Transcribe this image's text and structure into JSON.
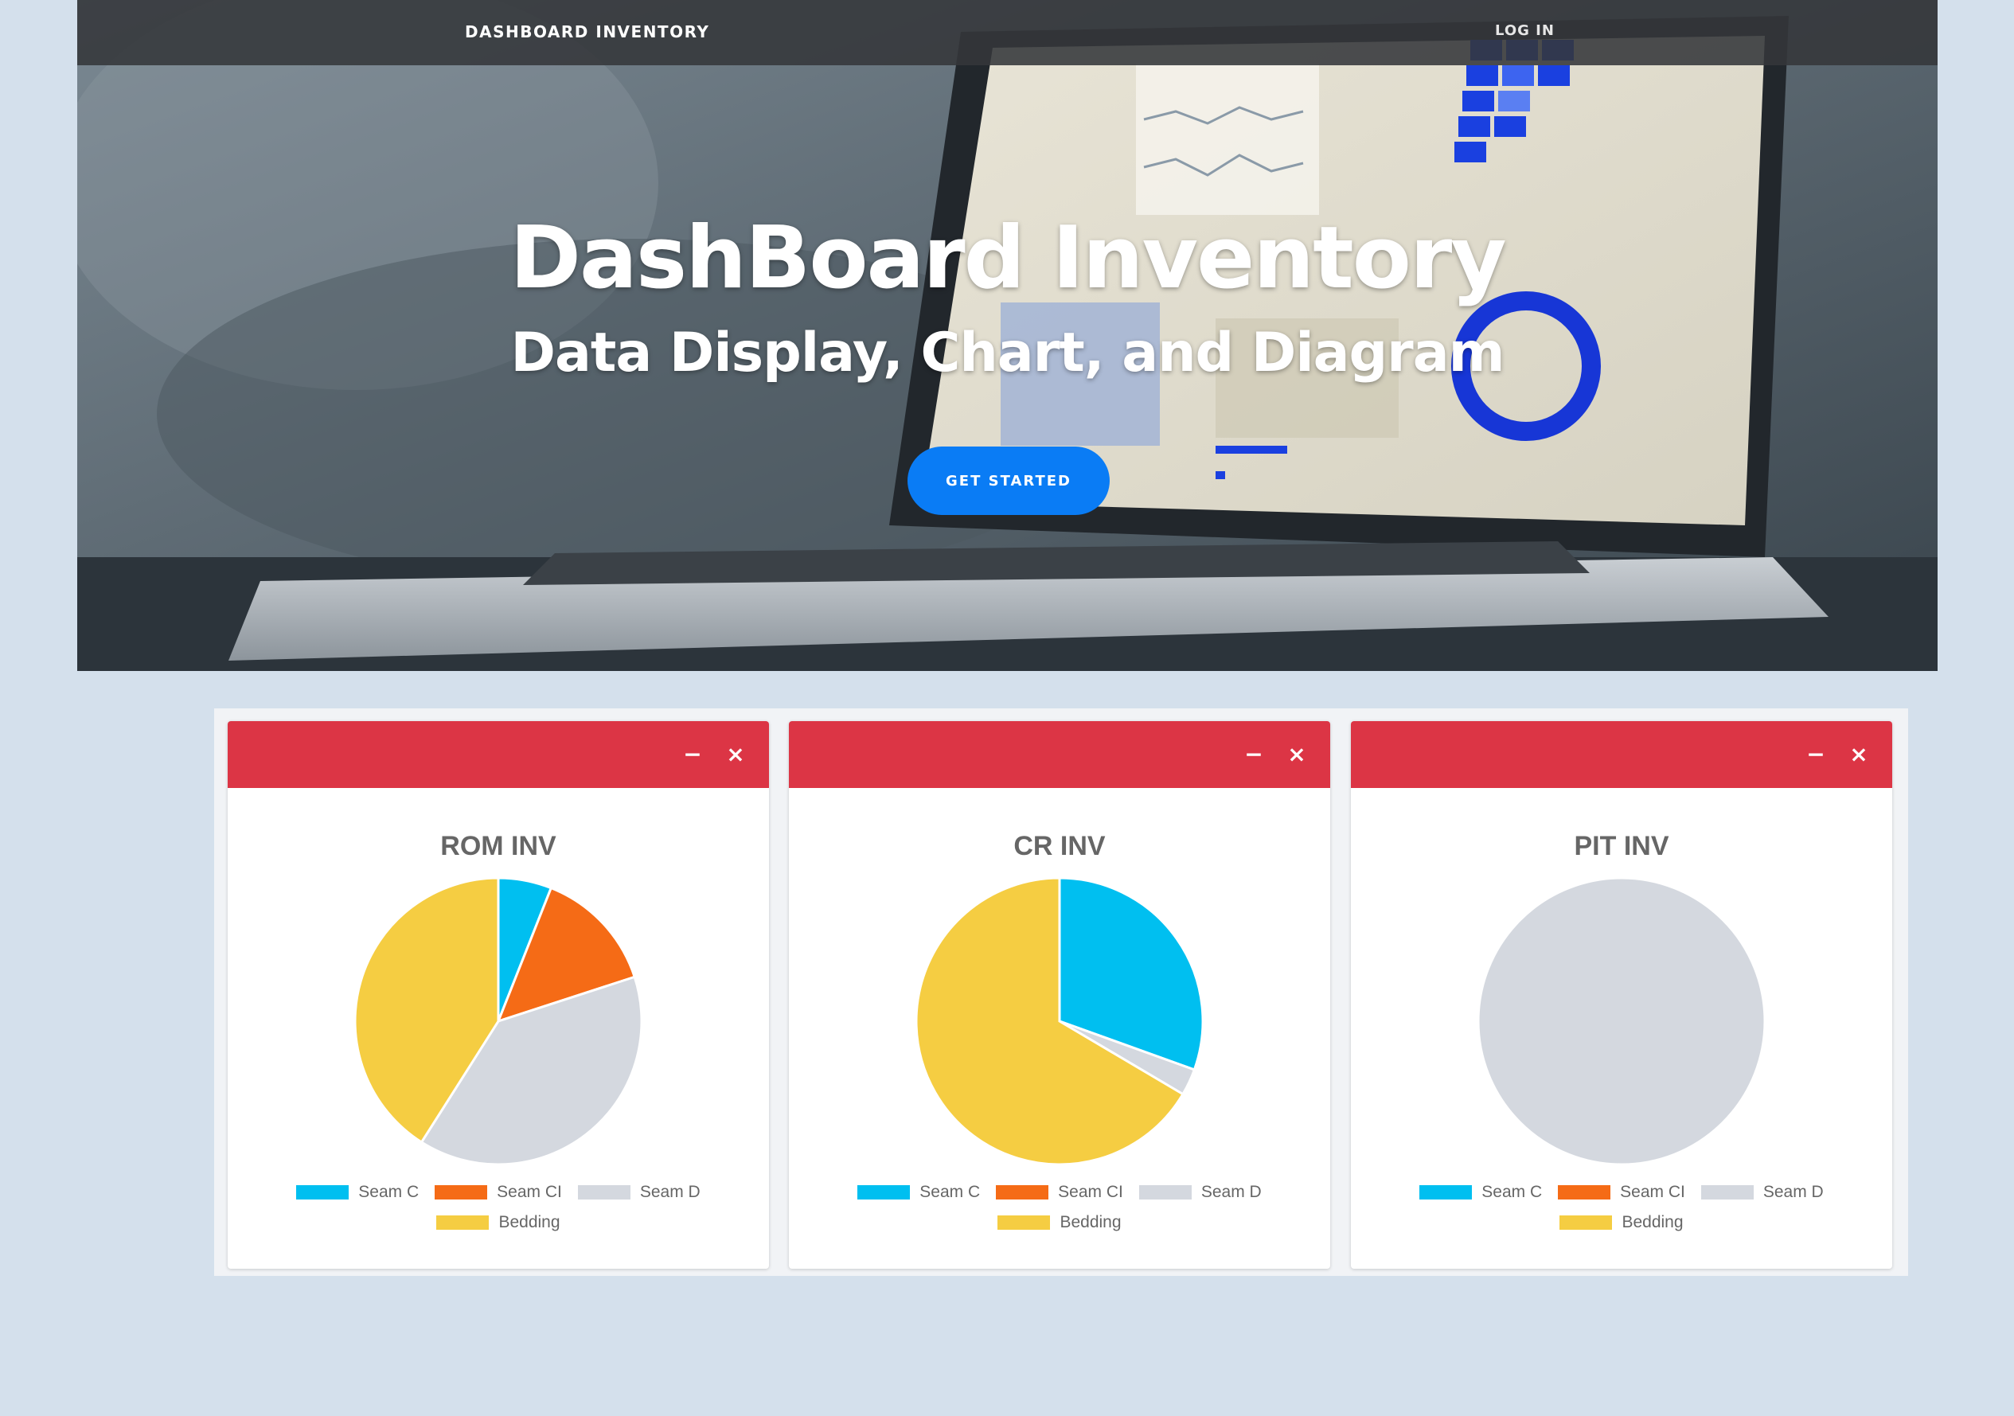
{
  "nav": {
    "brand": "DASHBOARD INVENTORY",
    "login": "LOG IN"
  },
  "hero": {
    "title": "DashBoard Inventory",
    "subtitle": "Data Display, Chart, and Diagram",
    "cta": "GET STARTED"
  },
  "colors": {
    "accent": "#dc3545",
    "cta": "#0a7cf5",
    "seam_c": "#00bff0",
    "seam_ci": "#f56b16",
    "seam_d": "#d4d8df",
    "bedding": "#f5cd42"
  },
  "icons": {
    "minimize": "minus-icon",
    "close": "close-icon"
  },
  "chart_data": [
    {
      "type": "pie",
      "title": "ROM INV",
      "labels": [
        "Seam C",
        "Seam CI",
        "Seam D",
        "Bedding"
      ],
      "values": [
        6,
        14,
        39,
        41
      ],
      "legend": "bottom"
    },
    {
      "type": "pie",
      "title": "CR INV",
      "labels": [
        "Seam C",
        "Seam CI",
        "Seam D",
        "Bedding"
      ],
      "values": [
        30.5,
        0,
        3,
        66.5
      ],
      "legend": "bottom"
    },
    {
      "type": "pie",
      "title": "PIT INV",
      "labels": [
        "Seam C",
        "Seam CI",
        "Seam D",
        "Bedding"
      ],
      "values": [
        0,
        0,
        100,
        0
      ],
      "legend": "bottom"
    }
  ]
}
